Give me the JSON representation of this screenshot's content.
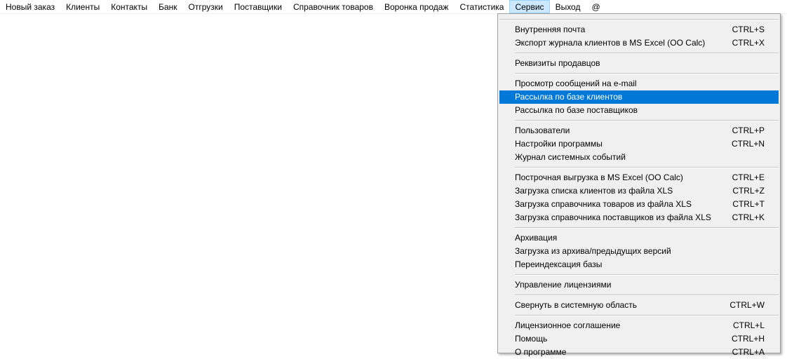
{
  "menubar": [
    "Новый заказ",
    "Клиенты",
    "Контакты",
    "Банк",
    "Отгрузки",
    "Поставщики",
    "Справочник товаров",
    "Воронка продаж",
    "Статистика",
    "Сервис",
    "Выход",
    "@"
  ],
  "active_menu": "Сервис",
  "dropdown": {
    "groups": [
      [
        {
          "label": "Внутренняя почта",
          "shortcut": "CTRL+S"
        },
        {
          "label": "Экспорт журнала клиентов в MS Excel (OO Calc)",
          "shortcut": "CTRL+X"
        }
      ],
      [
        {
          "label": "Реквизиты продавцов",
          "shortcut": ""
        }
      ],
      [
        {
          "label": "Просмотр сообщений на e-mail",
          "shortcut": ""
        },
        {
          "label": "Рассылка по базе клиентов",
          "shortcut": "",
          "highlighted": true
        },
        {
          "label": "Рассылка по базе поставщиков",
          "shortcut": ""
        }
      ],
      [
        {
          "label": "Пользователи",
          "shortcut": "CTRL+P"
        },
        {
          "label": "Настройки программы",
          "shortcut": "CTRL+N"
        },
        {
          "label": "Журнал системных событий",
          "shortcut": ""
        }
      ],
      [
        {
          "label": "Построчная выгрузка в MS Excel (OO Calc)",
          "shortcut": "CTRL+E"
        },
        {
          "label": "Загрузка списка клиентов из файла XLS",
          "shortcut": "CTRL+Z"
        },
        {
          "label": "Загрузка справочника товаров из файла XLS",
          "shortcut": "CTRL+T"
        },
        {
          "label": "Загрузка справочника поставщиков из файла XLS",
          "shortcut": "CTRL+K"
        }
      ],
      [
        {
          "label": "Архивация",
          "shortcut": ""
        },
        {
          "label": "Загрузка из архива/предыдущих версий",
          "shortcut": ""
        },
        {
          "label": "Переиндексация базы",
          "shortcut": ""
        }
      ],
      [
        {
          "label": "Управление лицензиями",
          "shortcut": ""
        }
      ],
      [
        {
          "label": "Свернуть в системную область",
          "shortcut": "CTRL+W"
        }
      ],
      [
        {
          "label": "Лицензионное соглашение",
          "shortcut": "CTRL+L"
        },
        {
          "label": "Помощь",
          "shortcut": "CTRL+H"
        },
        {
          "label": "О программе",
          "shortcut": "CTRL+A"
        }
      ]
    ]
  },
  "colors": {
    "highlight": "#0078d7",
    "active_menu_bg": "#cce8ff"
  }
}
